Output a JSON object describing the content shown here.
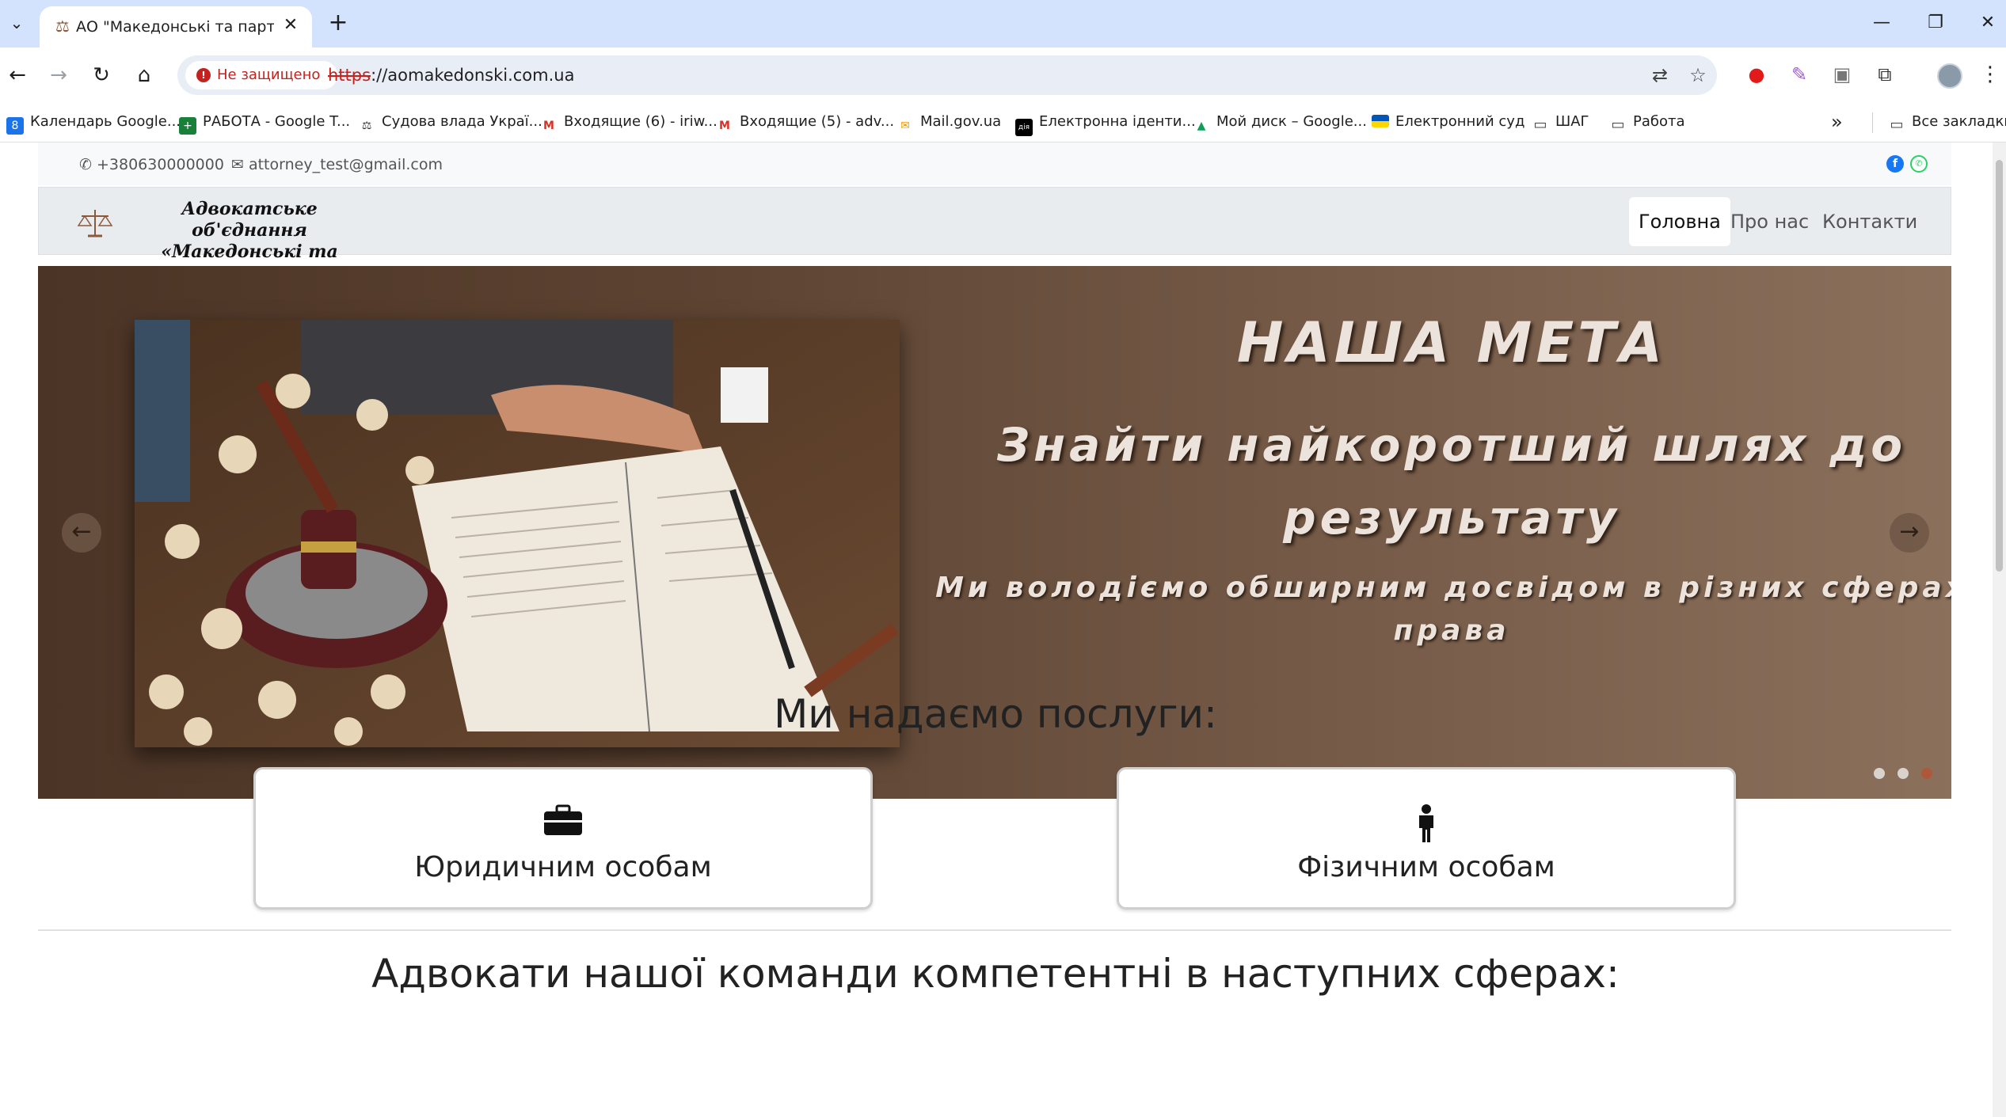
{
  "browser": {
    "tab_title": "АО \"Македонські та партнери\"",
    "tab_list_icon": "chevron-down",
    "new_tab_label": "+",
    "window_buttons": {
      "minimize": "—",
      "restore": "❐",
      "close": "✕"
    },
    "security_label": "Не защищено",
    "url_scheme": "https",
    "url_rest": "://aomakedonski.com.ua",
    "bookmarks": [
      {
        "label": "Календарь Google...",
        "icon": "google-calendar-icon",
        "color": "#1a73e8"
      },
      {
        "label": "РАБОТА - Google T...",
        "icon": "google-sheets-icon",
        "color": "#188038"
      },
      {
        "label": "Судова влада Украї...",
        "icon": "themis-icon",
        "color": "#333333"
      },
      {
        "label": "Входящие (6) - iriw...",
        "icon": "gmail-icon",
        "color": "#d93025"
      },
      {
        "label": "Входящие (5) - adv...",
        "icon": "gmail-icon",
        "color": "#d93025"
      },
      {
        "label": "Mail.gov.ua",
        "icon": "mail-gov-icon",
        "color": "#f29900"
      },
      {
        "label": "Електронна іденти...",
        "icon": "diia-icon",
        "color": "#000000"
      },
      {
        "label": "Мой диск – Google...",
        "icon": "google-drive-icon",
        "color": "#0f9d58"
      },
      {
        "label": "Електронний суд",
        "icon": "ukraine-flag-icon",
        "color": "#0057b7"
      },
      {
        "label": "ШАГ",
        "icon": "folder-icon",
        "color": "#444444"
      },
      {
        "label": "Работа",
        "icon": "folder-icon",
        "color": "#444444"
      }
    ],
    "more_bookmarks": "»",
    "all_bookmarks": "Все закладки"
  },
  "site": {
    "phone": "+380630000000",
    "email": "attorney_test@gmail.com",
    "brand_line1": "Адвокатське об'єднання",
    "brand_line2": "«Македонські та партнери»",
    "nav": [
      {
        "label": "Головна",
        "active": true
      },
      {
        "label": "Про нас",
        "active": false
      },
      {
        "label": "Контакти",
        "active": false
      }
    ],
    "hero": {
      "title": "НАША МЕТА",
      "subtitle": "Знайти найкоротший шлях до результату",
      "description": "Ми володіємо обширним досвідом в різних сферах права",
      "prev_arrow": "←",
      "next_arrow": "→",
      "slides_total": 3,
      "active_slide": 3
    },
    "services_title": "Ми надаємо послуги:",
    "services": [
      {
        "label": "Юридичним особам",
        "icon": "briefcase-icon"
      },
      {
        "label": "Фізичним особам",
        "icon": "person-icon"
      }
    ],
    "next_section_title": "Адвокати нашої команди компетентні в наступних сферах:"
  },
  "colors": {
    "accent": "#b0573a",
    "hero_start": "#4b3425",
    "hero_end": "#8b715c",
    "insecure": "#c5221f"
  }
}
